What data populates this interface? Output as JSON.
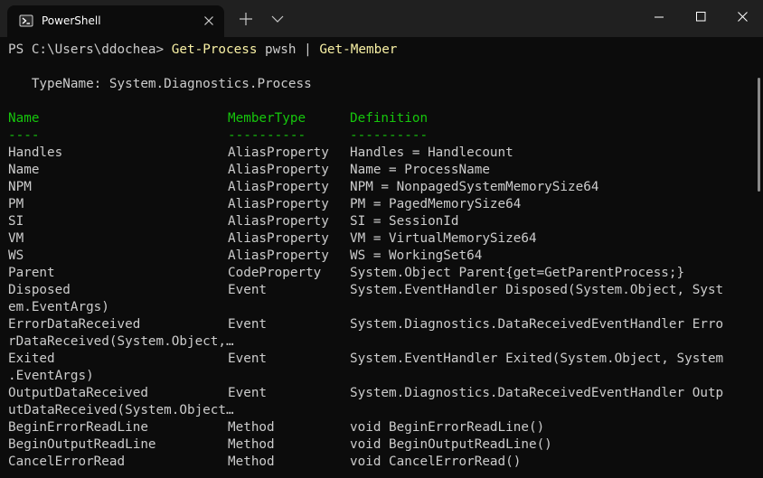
{
  "tab": {
    "title": "PowerShell"
  },
  "prompt": {
    "prefix": "PS C:\\Users\\ddochea> ",
    "cmd1": "Get-Process",
    "arg": " pwsh | ",
    "cmd2": "Get-Member"
  },
  "typename": "   TypeName: System.Diagnostics.Process",
  "headers": {
    "name": "Name",
    "membertype": "MemberType",
    "definition": "Definition",
    "name_rule": "----",
    "membertype_rule": "----------",
    "definition_rule": "----------"
  },
  "rows": [
    {
      "name": "Handles",
      "type": "AliasProperty",
      "def": "Handles = Handlecount"
    },
    {
      "name": "Name",
      "type": "AliasProperty",
      "def": "Name = ProcessName"
    },
    {
      "name": "NPM",
      "type": "AliasProperty",
      "def": "NPM = NonpagedSystemMemorySize64"
    },
    {
      "name": "PM",
      "type": "AliasProperty",
      "def": "PM = PagedMemorySize64"
    },
    {
      "name": "SI",
      "type": "AliasProperty",
      "def": "SI = SessionId"
    },
    {
      "name": "VM",
      "type": "AliasProperty",
      "def": "VM = VirtualMemorySize64"
    },
    {
      "name": "WS",
      "type": "AliasProperty",
      "def": "WS = WorkingSet64"
    },
    {
      "name": "Parent",
      "type": "CodeProperty",
      "def": "System.Object Parent{get=GetParentProcess;}"
    },
    {
      "name": "Disposed",
      "type": "Event",
      "def": "System.EventHandler Disposed(System.Object, Syst",
      "wrap": "em.EventArgs)"
    },
    {
      "name": "ErrorDataReceived",
      "type": "Event",
      "def": "System.Diagnostics.DataReceivedEventHandler Erro",
      "wrap": "rDataReceived(System.Object,…"
    },
    {
      "name": "Exited",
      "type": "Event",
      "def": "System.EventHandler Exited(System.Object, System",
      "wrap": ".EventArgs)"
    },
    {
      "name": "OutputDataReceived",
      "type": "Event",
      "def": "System.Diagnostics.DataReceivedEventHandler Outp",
      "wrap": "utDataReceived(System.Object…"
    },
    {
      "name": "BeginErrorReadLine",
      "type": "Method",
      "def": "void BeginErrorReadLine()"
    },
    {
      "name": "BeginOutputReadLine",
      "type": "Method",
      "def": "void BeginOutputReadLine()"
    },
    {
      "name": "CancelErrorRead",
      "type": "Method",
      "def": "void CancelErrorRead()"
    }
  ],
  "icons": {
    "tab_icon": "powershell-icon",
    "tab_close": "close-icon",
    "new_tab": "plus-icon",
    "dropdown": "chevron-down-icon",
    "minimize": "minimize-icon",
    "maximize": "maximize-icon",
    "close": "close-icon"
  },
  "colors": {
    "background": "#0c0c0c",
    "titlebar": "#202020",
    "text": "#cccccc",
    "header": "#16c60c",
    "command": "#f9f1a5"
  }
}
